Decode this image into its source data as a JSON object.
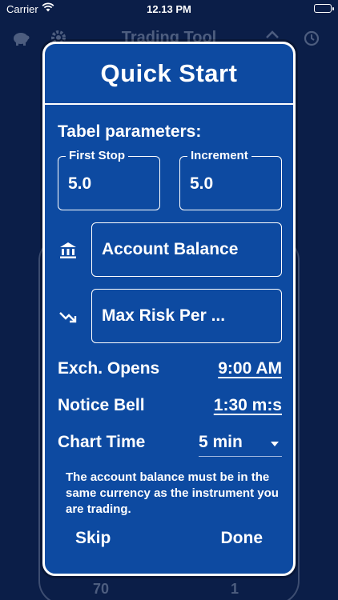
{
  "status_bar": {
    "carrier": "Carrier",
    "time": "12.13 PM"
  },
  "background_app": {
    "title": "Trading Tool",
    "bottom_left_number": "70",
    "bottom_right_number": "1"
  },
  "modal": {
    "title": "Quick Start",
    "section_label": "Tabel parameters:",
    "first_stop": {
      "label": "First Stop",
      "value": "5.0"
    },
    "increment": {
      "label": "Increment",
      "value": "5.0"
    },
    "account_balance": {
      "placeholder": "Account Balance",
      "icon": "bank-icon"
    },
    "max_risk": {
      "placeholder": "Max Risk Per ...",
      "icon": "trending-down-icon"
    },
    "exchange_opens": {
      "label": "Exch. Opens",
      "value": "9:00 AM"
    },
    "notice_bell": {
      "label": "Notice Bell",
      "value": "1:30 m:s"
    },
    "chart_time": {
      "label": "Chart Time",
      "value": "5 min"
    },
    "note": "The account balance must be in the same currency as the instrument you are trading.",
    "skip_label": "Skip",
    "done_label": "Done"
  },
  "colors": {
    "modal_background": "#0d4aa1",
    "page_background": "#0b1e48",
    "foreground": "#ffffff"
  }
}
